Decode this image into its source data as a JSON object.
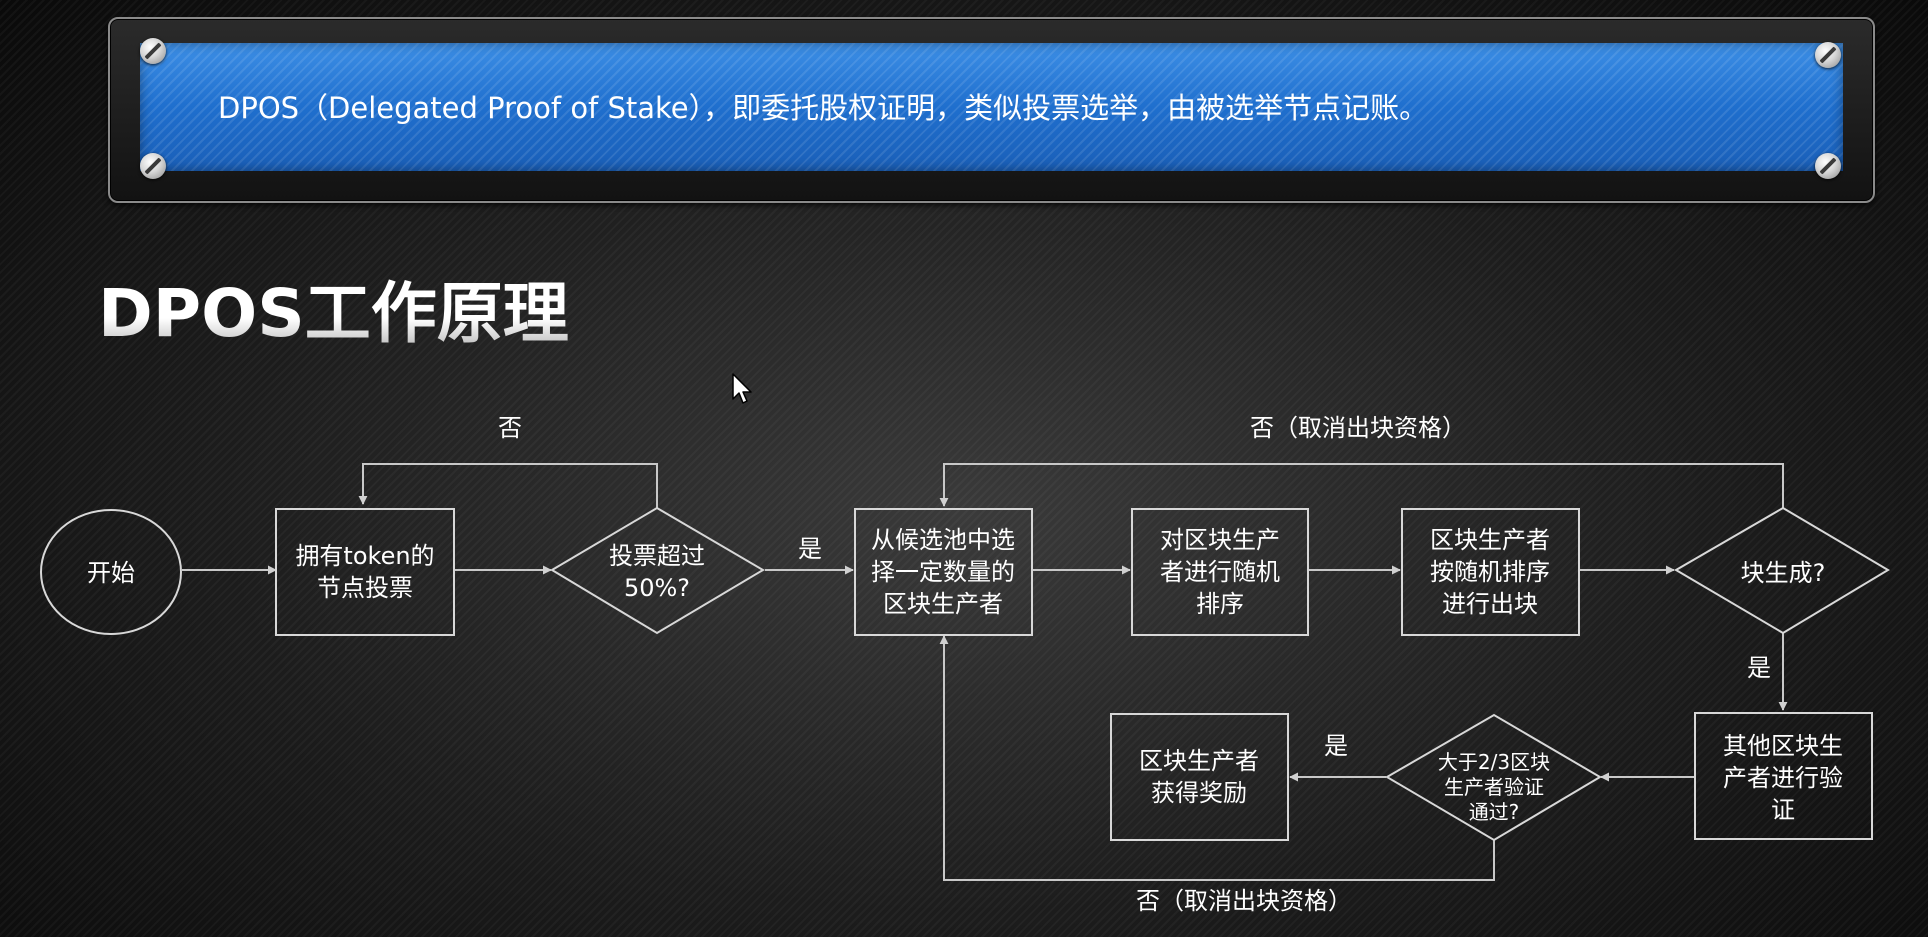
{
  "banner": {
    "text": "DPOS（Delegated Proof of Stake），即委托股权证明，类似投票选举，由被选举节点记账。"
  },
  "title": "DPOS工作原理",
  "flowchart": {
    "nodes": {
      "start": {
        "lines": [
          "开始"
        ]
      },
      "node_vote": {
        "lines": [
          "拥有token的",
          "节点投票"
        ]
      },
      "decision_50": {
        "lines": [
          "投票超过",
          "50%?"
        ]
      },
      "select_producers": {
        "lines": [
          "从候选池中选",
          "择一定数量的",
          "区块生产者"
        ]
      },
      "random_order": {
        "lines": [
          "对区块生产",
          "者进行随机",
          "排序"
        ]
      },
      "produce_blocks": {
        "lines": [
          "区块生产者",
          "按随机排序",
          "进行出块"
        ]
      },
      "decision_block": {
        "lines": [
          "块生成?"
        ]
      },
      "verify": {
        "lines": [
          "其他区块生",
          "产者进行验",
          "证"
        ]
      },
      "decision_23": {
        "lines": [
          "大于2/3区块",
          "生产者验证",
          "通过?"
        ]
      },
      "reward": {
        "lines": [
          "区块生产者",
          "获得奖励"
        ]
      }
    },
    "edge_labels": {
      "no_loop": "否",
      "yes_select": "是",
      "no_cancel_top": "否（取消出块资格）",
      "yes_block": "是",
      "yes_reward": "是",
      "no_cancel_bottom": "否（取消出块资格）"
    }
  },
  "colors": {
    "banner_blue": "#1f6fce",
    "line": "#d0d0d0",
    "text": "#ffffff"
  }
}
